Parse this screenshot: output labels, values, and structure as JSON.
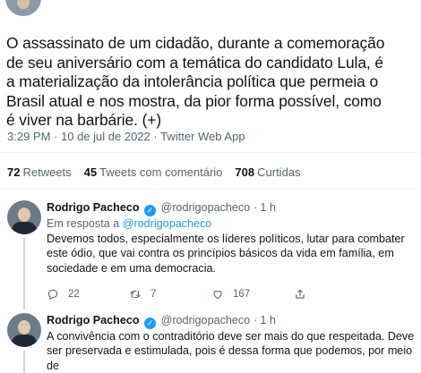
{
  "tweet": {
    "text": "O assassinato de um cidadão, durante a comemoração\nde seu aniversário com a temática do candidato Lula, é\na materialização da intolerância política que permeia o\nBrasil atual e nos mostra, da pior forma possível, como\né viver na barbárie. (+)",
    "time": "3:29 PM",
    "date": "10 de jul de 2022",
    "source": "Twitter Web App",
    "separator": "·"
  },
  "stats": {
    "retweets_count": "72",
    "retweets_label": "Retweets",
    "quotes_count": "45",
    "quotes_label": "Tweets com comentário",
    "likes_count": "708",
    "likes_label": "Curtidas"
  },
  "replies": [
    {
      "name": "Rodrigo Pacheco",
      "handle": "@rodrigopacheco",
      "dot": "·",
      "time": "1 h",
      "in_reply_prefix": "Em resposta a",
      "in_reply_handle": "@rodrigopacheco",
      "text": "Devemos todos, especialmente os líderes políticos, lutar para combater\neste ódio, que vai contra os princípios básicos da vida em família, em\nsociedade e em uma democracia.",
      "reply_count": "22",
      "retweet_count": "7",
      "like_count": "167"
    },
    {
      "name": "Rodrigo Pacheco",
      "handle": "@rodrigopacheco",
      "dot": "·",
      "time": "1 h",
      "text": "A convivência com o contraditório deve ser mais do que respeitada. Deve\nser preservada e estimulada, pois é dessa forma que podemos, por meio de\ndiálogo e busca de consensos, evoluir para um país melhor."
    }
  ],
  "icons": {
    "verified": "verified-badge-icon",
    "reply": "reply-icon",
    "retweet": "retweet-icon",
    "like": "heart-icon",
    "share": "share-icon"
  },
  "colors": {
    "accent": "#1d9bf0",
    "secondary_text": "#536471",
    "primary_text": "#0f1419"
  }
}
